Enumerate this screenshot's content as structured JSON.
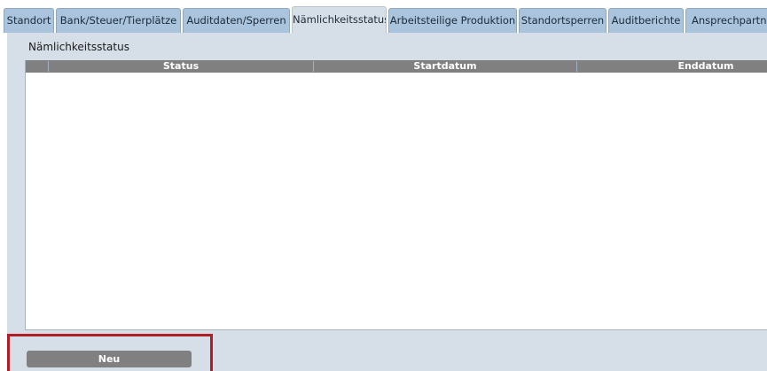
{
  "tabs": [
    {
      "label": "Standort",
      "active": false
    },
    {
      "label": "Bank/Steuer/Tierplätze",
      "active": false
    },
    {
      "label": "Auditdaten/Sperren",
      "active": false
    },
    {
      "label": "Nämlichkeitsstatus",
      "active": true
    },
    {
      "label": "Arbeitsteilige Produktion",
      "active": false
    },
    {
      "label": "Standortsperren",
      "active": false
    },
    {
      "label": "Auditberichte",
      "active": false
    },
    {
      "label": "Ansprechpartne",
      "active": false
    }
  ],
  "panel": {
    "title": "Nämlichkeitsstatus"
  },
  "table": {
    "columns": [
      "Status",
      "Startdatum",
      "Enddatum"
    ],
    "rows": []
  },
  "actions": {
    "new_label": "Neu"
  },
  "colors": {
    "tab_inactive": "#a9c4dc",
    "tab_active": "#d6dfe7",
    "panel_background": "#d6dfe7",
    "header_background": "#808080",
    "button_background": "#808080",
    "highlight_border": "#b01e25"
  }
}
